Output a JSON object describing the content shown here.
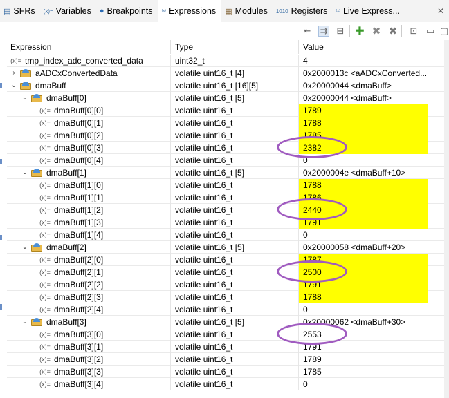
{
  "tabs": [
    {
      "icon": "sfr-icon",
      "glyph": "▤",
      "label": "SFRs",
      "active": false
    },
    {
      "icon": "variables-icon",
      "glyph": "(x)=",
      "label": "Variables",
      "active": false
    },
    {
      "icon": "breakpoints-icon",
      "glyph": "●",
      "label": "Breakpoints",
      "active": false
    },
    {
      "icon": "expressions-icon",
      "glyph": "⁽ˣ⁾",
      "label": "Expressions",
      "active": true
    },
    {
      "icon": "modules-icon",
      "glyph": "▦",
      "label": "Modules",
      "active": false
    },
    {
      "icon": "registers-icon",
      "glyph": "1010",
      "label": "Registers",
      "active": false
    },
    {
      "icon": "live-expressions-icon",
      "glyph": "⁽ˣ⁾",
      "label": "Live Express...",
      "active": false
    }
  ],
  "columns": {
    "expression": "Expression",
    "type": "Type",
    "value": "Value"
  },
  "rows": [
    {
      "name": "tmp_index_adc_converted_data",
      "type": "uint32_t",
      "value": "4",
      "level": 0,
      "kind": "var",
      "twisty": "",
      "hl": false
    },
    {
      "name": "aADCxConvertedData",
      "type": "volatile uint16_t [4]",
      "value": "0x2000013c <aADCxConverted...",
      "level": 0,
      "kind": "folder",
      "twisty": "›",
      "hl": false
    },
    {
      "name": "dmaBuff",
      "type": "volatile uint16_t [16][5]",
      "value": "0x20000044 <dmaBuff>",
      "level": 0,
      "kind": "folder",
      "twisty": "⌄",
      "hl": false
    },
    {
      "name": "dmaBuff[0]",
      "type": "volatile uint16_t [5]",
      "value": "0x20000044 <dmaBuff>",
      "level": 1,
      "kind": "folder",
      "twisty": "⌄",
      "hl": false
    },
    {
      "name": "dmaBuff[0][0]",
      "type": "volatile uint16_t",
      "value": "1789",
      "level": 2,
      "kind": "var",
      "twisty": "",
      "hl": true
    },
    {
      "name": "dmaBuff[0][1]",
      "type": "volatile uint16_t",
      "value": "1788",
      "level": 2,
      "kind": "var",
      "twisty": "",
      "hl": true
    },
    {
      "name": "dmaBuff[0][2]",
      "type": "volatile uint16_t",
      "value": "1785",
      "level": 2,
      "kind": "var",
      "twisty": "",
      "hl": true
    },
    {
      "name": "dmaBuff[0][3]",
      "type": "volatile uint16_t",
      "value": "2382",
      "level": 2,
      "kind": "var",
      "twisty": "",
      "hl": true
    },
    {
      "name": "dmaBuff[0][4]",
      "type": "volatile uint16_t",
      "value": "0",
      "level": 2,
      "kind": "var",
      "twisty": "",
      "hl": false
    },
    {
      "name": "dmaBuff[1]",
      "type": "volatile uint16_t [5]",
      "value": "0x2000004e <dmaBuff+10>",
      "level": 1,
      "kind": "folder",
      "twisty": "⌄",
      "hl": false
    },
    {
      "name": "dmaBuff[1][0]",
      "type": "volatile uint16_t",
      "value": "1788",
      "level": 2,
      "kind": "var",
      "twisty": "",
      "hl": true
    },
    {
      "name": "dmaBuff[1][1]",
      "type": "volatile uint16_t",
      "value": "1786",
      "level": 2,
      "kind": "var",
      "twisty": "",
      "hl": true
    },
    {
      "name": "dmaBuff[1][2]",
      "type": "volatile uint16_t",
      "value": "2440",
      "level": 2,
      "kind": "var",
      "twisty": "",
      "hl": true
    },
    {
      "name": "dmaBuff[1][3]",
      "type": "volatile uint16_t",
      "value": "1791",
      "level": 2,
      "kind": "var",
      "twisty": "",
      "hl": true
    },
    {
      "name": "dmaBuff[1][4]",
      "type": "volatile uint16_t",
      "value": "0",
      "level": 2,
      "kind": "var",
      "twisty": "",
      "hl": false
    },
    {
      "name": "dmaBuff[2]",
      "type": "volatile uint16_t [5]",
      "value": "0x20000058 <dmaBuff+20>",
      "level": 1,
      "kind": "folder",
      "twisty": "⌄",
      "hl": false
    },
    {
      "name": "dmaBuff[2][0]",
      "type": "volatile uint16_t",
      "value": "1787",
      "level": 2,
      "kind": "var",
      "twisty": "",
      "hl": true
    },
    {
      "name": "dmaBuff[2][1]",
      "type": "volatile uint16_t",
      "value": "2500",
      "level": 2,
      "kind": "var",
      "twisty": "",
      "hl": true
    },
    {
      "name": "dmaBuff[2][2]",
      "type": "volatile uint16_t",
      "value": "1791",
      "level": 2,
      "kind": "var",
      "twisty": "",
      "hl": true
    },
    {
      "name": "dmaBuff[2][3]",
      "type": "volatile uint16_t",
      "value": "1788",
      "level": 2,
      "kind": "var",
      "twisty": "",
      "hl": true
    },
    {
      "name": "dmaBuff[2][4]",
      "type": "volatile uint16_t",
      "value": "0",
      "level": 2,
      "kind": "var",
      "twisty": "",
      "hl": false
    },
    {
      "name": "dmaBuff[3]",
      "type": "volatile uint16_t [5]",
      "value": "0x20000062 <dmaBuff+30>",
      "level": 1,
      "kind": "folder",
      "twisty": "⌄",
      "hl": false
    },
    {
      "name": "dmaBuff[3][0]",
      "type": "volatile uint16_t",
      "value": "2553",
      "level": 2,
      "kind": "var",
      "twisty": "",
      "hl": false
    },
    {
      "name": "dmaBuff[3][1]",
      "type": "volatile uint16_t",
      "value": "1791",
      "level": 2,
      "kind": "var",
      "twisty": "",
      "hl": false
    },
    {
      "name": "dmaBuff[3][2]",
      "type": "volatile uint16_t",
      "value": "1789",
      "level": 2,
      "kind": "var",
      "twisty": "",
      "hl": false
    },
    {
      "name": "dmaBuff[3][3]",
      "type": "volatile uint16_t",
      "value": "1785",
      "level": 2,
      "kind": "var",
      "twisty": "",
      "hl": false
    },
    {
      "name": "dmaBuff[3][4]",
      "type": "volatile uint16_t",
      "value": "0",
      "level": 2,
      "kind": "var",
      "twisty": "",
      "hl": false
    }
  ],
  "var_glyph": "(x)=",
  "highlight_color": "#ffff00",
  "annotation_color": "#a05bc0",
  "circled_values": [
    "2382",
    "2440",
    "2500",
    "2553"
  ]
}
